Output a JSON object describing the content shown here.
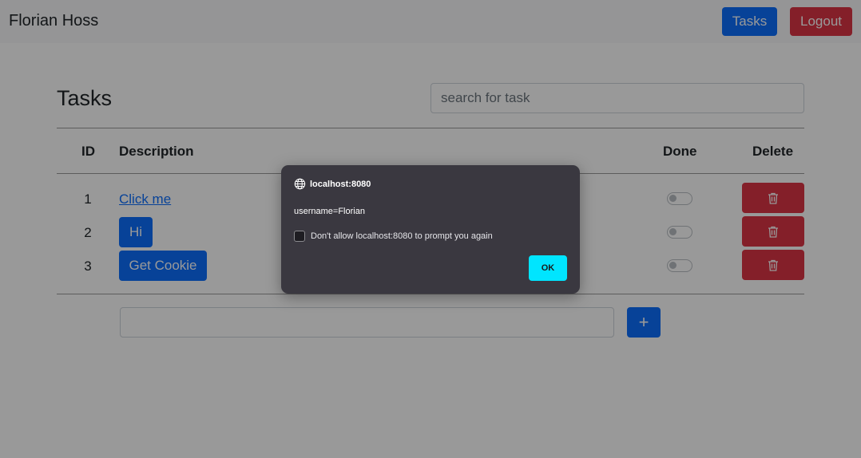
{
  "navbar": {
    "brand": "Florian Hoss",
    "tasks_label": "Tasks",
    "logout_label": "Logout"
  },
  "page": {
    "title": "Tasks",
    "search_placeholder": "search for task"
  },
  "table": {
    "headers": {
      "id": "ID",
      "description": "Description",
      "done": "Done",
      "delete": "Delete"
    },
    "rows": [
      {
        "id": "1",
        "description": "Click me",
        "kind": "link",
        "done": false
      },
      {
        "id": "2",
        "description": "Hi",
        "kind": "button",
        "done": false
      },
      {
        "id": "3",
        "description": "Get Cookie",
        "kind": "button",
        "done": false
      }
    ]
  },
  "add_task": {
    "input_value": "",
    "add_label": "+"
  },
  "dialog": {
    "origin": "localhost:8080",
    "message": "username=Florian",
    "checkbox_label": "Don't allow localhost:8080 to prompt you again",
    "checkbox_checked": false,
    "ok_label": "OK"
  },
  "colors": {
    "primary": "#0d6efd",
    "danger": "#dc3545",
    "dialog_bg": "#3a3840",
    "ok_button": "#00e5ff"
  }
}
